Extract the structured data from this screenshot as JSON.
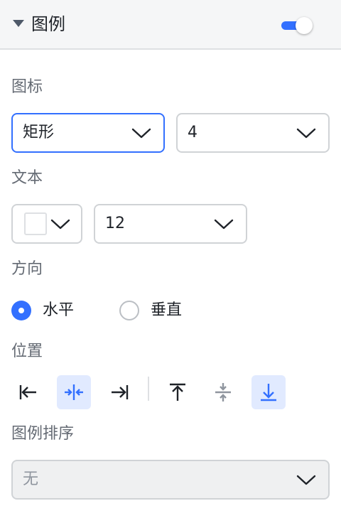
{
  "panel": {
    "title": "图例",
    "enabled": true
  },
  "icon_section": {
    "label": "图标",
    "shape_value": "矩形",
    "size_value": "4"
  },
  "text_section": {
    "label": "文本",
    "color_value": "#ffffff",
    "font_size_value": "12"
  },
  "direction_section": {
    "label": "方向",
    "options": [
      "水平",
      "垂直"
    ],
    "selected": "水平"
  },
  "position_section": {
    "label": "位置",
    "buttons": [
      {
        "icon": "align-left-icon",
        "selected": false
      },
      {
        "icon": "align-horizontal-center-icon",
        "selected": true
      },
      {
        "icon": "align-right-icon",
        "selected": false
      },
      {
        "icon": "align-top-icon",
        "selected": false
      },
      {
        "icon": "align-vertical-center-icon",
        "selected": false
      },
      {
        "icon": "align-bottom-icon",
        "selected": true
      }
    ]
  },
  "sort_section": {
    "label": "图例排序",
    "value": "无",
    "disabled": true
  },
  "colors": {
    "accent": "#3370ff",
    "selected_bg": "#e1eaff",
    "muted_icon": "#8f959e"
  }
}
